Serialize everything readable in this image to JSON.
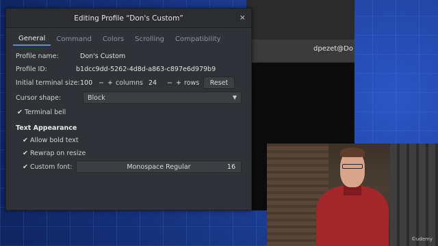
{
  "dialog": {
    "title": "Editing Profile “Don's Custom”",
    "close_glyph": "×",
    "tabs": [
      "General",
      "Command",
      "Colors",
      "Scrolling",
      "Compatibility"
    ],
    "active_tab": "General"
  },
  "general": {
    "profile_name_label": "Profile name:",
    "profile_name_value": "Don's Custom",
    "profile_id_label": "Profile ID:",
    "profile_id_value": "b1dcc9dd-5262-4d8d-a863-c897e6d979b9",
    "terminal_size_label": "Initial terminal size:",
    "columns_value": "100",
    "columns_label": "columns",
    "rows_value": "24",
    "rows_label": "rows",
    "minus": "−",
    "plus": "+",
    "reset_label": "Reset",
    "cursor_shape_label": "Cursor shape:",
    "cursor_shape_value": "Block",
    "terminal_bell_label": "Terminal bell",
    "terminal_bell_checked": true,
    "text_appearance_heading": "Text Appearance",
    "allow_bold_label": "Allow bold text",
    "rewrap_label": "Rewrap on resize",
    "custom_font_label": "Custom font:",
    "font_name": "Monospace Regular",
    "font_size": "16",
    "check_glyph": "✔"
  },
  "terminal": {
    "user_prompt": "dpezet@Do"
  },
  "watermark": "©udemy",
  "colors": {
    "accent": "#5a8fd8",
    "dialog_bg": "#2f3236",
    "background_blue": "#16306e"
  }
}
